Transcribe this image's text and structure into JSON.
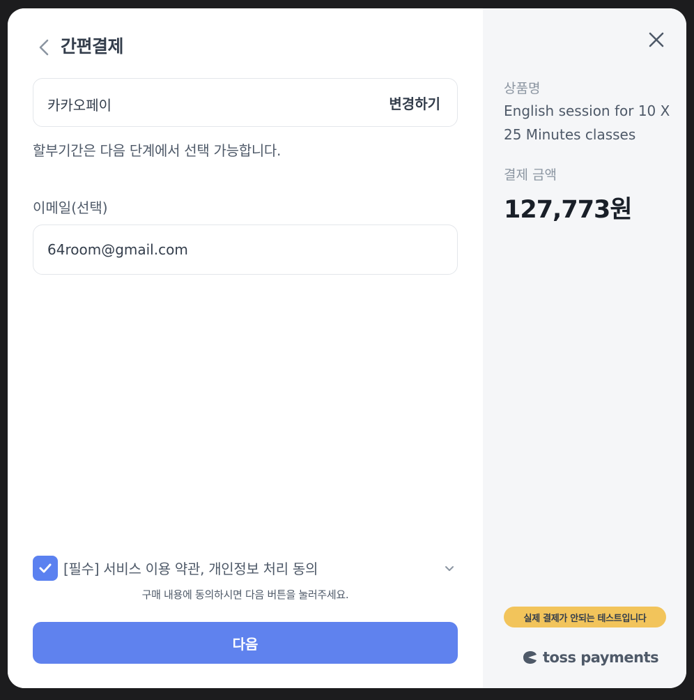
{
  "header": {
    "title": "간편결제"
  },
  "payment_method": {
    "name": "카카오페이",
    "change_label": "변경하기"
  },
  "installment_note": "할부기간은 다음 단계에서 선택 가능합니다.",
  "email": {
    "label": "이메일(선택)",
    "value": "64room@gmail.com"
  },
  "agreement": {
    "checked": true,
    "label": "[필수] 서비스 이용 약관, 개인정보 처리 동의",
    "guide": "구매 내용에 동의하시면 다음 버튼을 눌러주세요."
  },
  "next_button": {
    "label": "다음"
  },
  "summary": {
    "product_label": "상품명",
    "product_name": "English session for 10 X 25 Minutes classes",
    "amount_label": "결제 금액",
    "amount_value": "127,773원"
  },
  "test_badge": "실제 결제가 안되는 테스트입니다",
  "brand": {
    "name": "toss payments"
  },
  "colors": {
    "primary": "#5f82ee",
    "badge": "#f2c45b",
    "sidebar_bg": "#f5f6f8"
  },
  "icons": {
    "back": "chevron-left-icon",
    "close": "close-icon",
    "expand": "chevron-down-icon",
    "check": "check-icon",
    "logo": "toss-logo-icon"
  }
}
